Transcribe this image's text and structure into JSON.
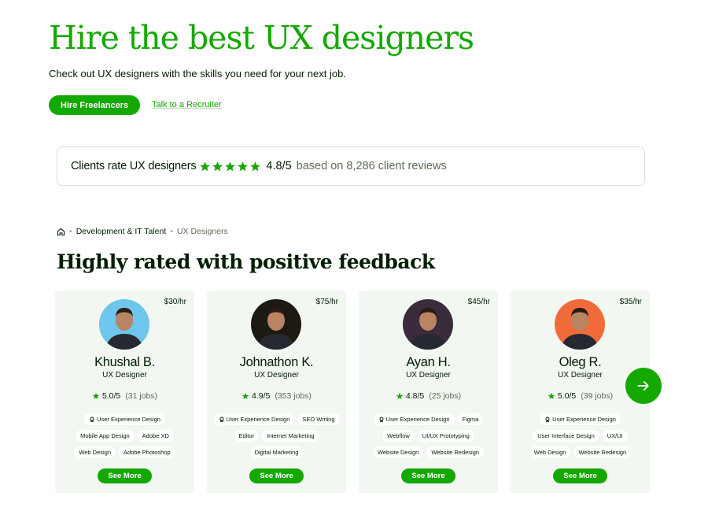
{
  "hero": {
    "title": "Hire the best UX designers",
    "subtitle": "Check out UX designers with the skills you need for your next job.",
    "primary_button": "Hire Freelancers",
    "secondary_link": "Talk to a Recruiter"
  },
  "rating": {
    "label": "Clients rate UX designers",
    "stars": 5,
    "score": "4.8/5",
    "reviews": "based on 8,286 client reviews"
  },
  "breadcrumb": {
    "home_icon": "home-icon",
    "level1": "Development & IT Talent",
    "level2": "UX Designers"
  },
  "section_title": "Highly rated with positive feedback",
  "colors": {
    "brand": "#14a800",
    "text": "#001e00",
    "card_bg": "#f2f7f2"
  },
  "freelancers": [
    {
      "rate": "$30/hr",
      "name": "Khushal B.",
      "role": "UX Designer",
      "score": "5.0/5",
      "jobs": "(31 jobs)",
      "skills": [
        "User Experience Design",
        "Mobile App Design",
        "Adobe XD",
        "Web Design",
        "Adobe Photoshop"
      ],
      "avatar_bg": "#6fc6ec",
      "see_more": "See More"
    },
    {
      "rate": "$75/hr",
      "name": "Johnathon K.",
      "role": "UX Designer",
      "score": "4.9/5",
      "jobs": "(353 jobs)",
      "skills": [
        "User Experience Design",
        "SEO Writing",
        "Editor",
        "Internet Marketing",
        "Digital Marketing"
      ],
      "avatar_bg": "#1d1a14",
      "see_more": "See More"
    },
    {
      "rate": "$45/hr",
      "name": "Ayan H.",
      "role": "UX Designer",
      "score": "4.8/5",
      "jobs": "(25 jobs)",
      "skills": [
        "User Experience Design",
        "Figma",
        "Webflow",
        "UI/UX Prototyping",
        "Website Design",
        "Website Redesign"
      ],
      "avatar_bg": "#3a2c3c",
      "see_more": "See More"
    },
    {
      "rate": "$35/hr",
      "name": "Oleg R.",
      "role": "UX Designer",
      "score": "5.0/5",
      "jobs": "(39 jobs)",
      "skills": [
        "User Experience Design",
        "User Interface Design",
        "UX/UI",
        "Web Design",
        "Website Redesign"
      ],
      "avatar_bg": "#f06a3a",
      "see_more": "See More"
    }
  ],
  "carousel": {
    "next_icon": "arrow-right-icon"
  }
}
